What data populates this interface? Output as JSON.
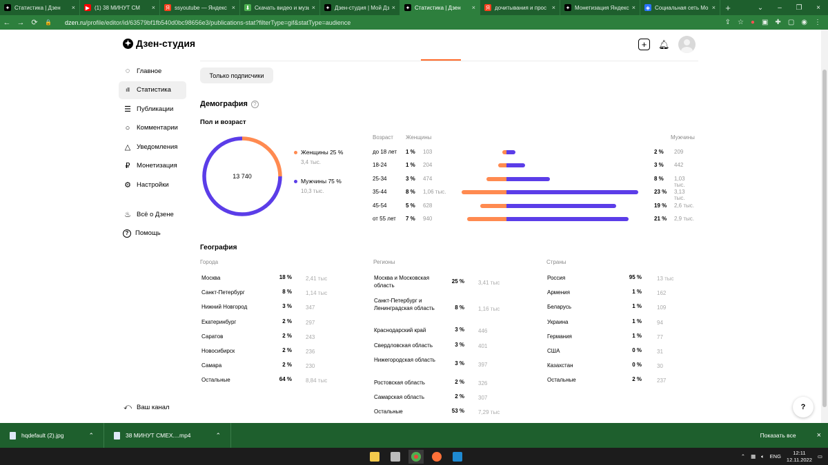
{
  "browser": {
    "tabs": [
      {
        "title": "Статистика | Дзен",
        "icon": "dzen-icon",
        "color": "#000000"
      },
      {
        "title": "(1) 38 МИНУТ СМ",
        "icon": "youtube-icon",
        "color": "#ff0000"
      },
      {
        "title": "ssyoutube — Яндекс",
        "icon": "yandex-icon",
        "color": "#fc3f1d"
      },
      {
        "title": "Скачать видео и музы",
        "icon": "download-icon",
        "color": "#4caf50"
      },
      {
        "title": "Дзен-студия | Мой Дз",
        "icon": "dzen-icon",
        "color": "#000000"
      },
      {
        "title": "Статистика | Дзен",
        "icon": "dzen-icon",
        "color": "#000000"
      },
      {
        "title": "дочитывания и прос",
        "icon": "yandex-icon",
        "color": "#fc3f1d"
      },
      {
        "title": "Монетизация Яндекс",
        "icon": "dzen-icon",
        "color": "#000000"
      },
      {
        "title": "Социальная сеть Мо",
        "icon": "social-icon",
        "color": "#2a73ff"
      }
    ],
    "active_tab": 5,
    "url_host": "dzen.ru",
    "url_path": "/profile/editor/id/63579bf1fb540d0bc98656e3/publications-stat?filterType=gif&statType=audience"
  },
  "studio": {
    "logo": "Дзен-студия",
    "nav": [
      {
        "label": "Главное",
        "icon": "planet-icon",
        "name": "nav-main"
      },
      {
        "label": "Статистика",
        "icon": "bars-icon",
        "name": "nav-statistics"
      },
      {
        "label": "Публикации",
        "icon": "stack-icon",
        "name": "nav-publications"
      },
      {
        "label": "Комментарии",
        "icon": "comment-icon",
        "name": "nav-comments"
      },
      {
        "label": "Уведомления",
        "icon": "bell-icon",
        "name": "nav-notifications"
      },
      {
        "label": "Монетизация",
        "icon": "ruble-icon",
        "name": "nav-monetization"
      },
      {
        "label": "Настройки",
        "icon": "gear-icon",
        "name": "nav-settings"
      }
    ],
    "nav_secondary": [
      {
        "label": "Всё о Дзене",
        "icon": "flame-icon",
        "name": "nav-about"
      },
      {
        "label": "Помощь",
        "icon": "help-icon",
        "name": "nav-help"
      }
    ],
    "your_channel": "Ваш канал",
    "filter_button": "Только подписчики",
    "help_button": "?"
  },
  "demography": {
    "title": "Демография",
    "gender_age_title": "Пол и возраст",
    "total": "13 740",
    "women": {
      "label": "Женщины 25 %",
      "sub": "3,4 тыс.",
      "share": 0.25,
      "color": "#ff8a50"
    },
    "men": {
      "label": "Мужчины 75 %",
      "sub": "10,3 тыс.",
      "share": 0.75,
      "color": "#5b3de8"
    },
    "age_header": "Возраст",
    "women_header": "Женщины",
    "men_header": "Мужчины",
    "age_rows": [
      {
        "age": "до 18 лет",
        "f_pct": "1 %",
        "f_val": "103",
        "f_num": 103,
        "m_pct": "2 %",
        "m_val": "209",
        "m_num": 209
      },
      {
        "age": "18-24",
        "f_pct": "1 %",
        "f_val": "204",
        "f_num": 204,
        "m_pct": "3 %",
        "m_val": "442",
        "m_num": 442
      },
      {
        "age": "25-34",
        "f_pct": "3 %",
        "f_val": "474",
        "f_num": 474,
        "m_pct": "8 %",
        "m_val": "1,03 тыс.",
        "m_num": 1030
      },
      {
        "age": "35-44",
        "f_pct": "8 %",
        "f_val": "1,06 тыс.",
        "f_num": 1060,
        "m_pct": "23 %",
        "m_val": "3,13 тыс.",
        "m_num": 3130
      },
      {
        "age": "45-54",
        "f_pct": "5 %",
        "f_val": "628",
        "f_num": 628,
        "m_pct": "19 %",
        "m_val": "2,6 тыс.",
        "m_num": 2600
      },
      {
        "age": "от 55 лет",
        "f_pct": "7 %",
        "f_val": "940",
        "f_num": 940,
        "m_pct": "21 %",
        "m_val": "2,9 тыс.",
        "m_num": 2900
      }
    ]
  },
  "geography": {
    "title": "География",
    "cities_header": "Города",
    "regions_header": "Регионы",
    "countries_header": "Страны",
    "cities": [
      {
        "name": "Москва",
        "pct": "18 %",
        "val": "2,41 тыс"
      },
      {
        "name": "Санкт-Петербург",
        "pct": "8 %",
        "val": "1,14 тыс"
      },
      {
        "name": "Нижний Новгород",
        "pct": "3 %",
        "val": "347"
      },
      {
        "name": "Екатеринбург",
        "pct": "2 %",
        "val": "297"
      },
      {
        "name": "Саратов",
        "pct": "2 %",
        "val": "243"
      },
      {
        "name": "Новосибирск",
        "pct": "2 %",
        "val": "236"
      },
      {
        "name": "Самара",
        "pct": "2 %",
        "val": "230"
      },
      {
        "name": "Остальные",
        "pct": "64 %",
        "val": "8,84 тыс"
      }
    ],
    "regions": [
      {
        "name": "Москва и Московская область",
        "pct": "25 %",
        "val": "3,41 тыс"
      },
      {
        "name": "Санкт-Петербург и Ленинградская область",
        "pct": "8 %",
        "val": "1,16 тыс"
      },
      {
        "name": "Краснодарский край",
        "pct": "3 %",
        "val": "446"
      },
      {
        "name": "Свердловская область",
        "pct": "3 %",
        "val": "401"
      },
      {
        "name": "Нижегородская область",
        "pct": "3 %",
        "val": "397"
      },
      {
        "name": "Ростовская область",
        "pct": "2 %",
        "val": "326"
      },
      {
        "name": "Самарская область",
        "pct": "2 %",
        "val": "307"
      },
      {
        "name": "Остальные",
        "pct": "53 %",
        "val": "7,29 тыс"
      }
    ],
    "countries": [
      {
        "name": "Россия",
        "pct": "95 %",
        "val": "13 тыс"
      },
      {
        "name": "Армения",
        "pct": "1 %",
        "val": "162"
      },
      {
        "name": "Беларусь",
        "pct": "1 %",
        "val": "109"
      },
      {
        "name": "Украина",
        "pct": "1 %",
        "val": "94"
      },
      {
        "name": "Германия",
        "pct": "1 %",
        "val": "77"
      },
      {
        "name": "США",
        "pct": "0 %",
        "val": "31"
      },
      {
        "name": "Казахстан",
        "pct": "0 %",
        "val": "30"
      },
      {
        "name": "Остальные",
        "pct": "2 %",
        "val": "237"
      }
    ]
  },
  "downloads": {
    "items": [
      {
        "name": "hqdefault (2).jpg"
      },
      {
        "name": "38 МИНУТ СМЕХ....mp4"
      }
    ],
    "show_all": "Показать все"
  },
  "taskbar": {
    "lang": "ENG",
    "time": "12:11",
    "date": "12.11.2022"
  }
}
